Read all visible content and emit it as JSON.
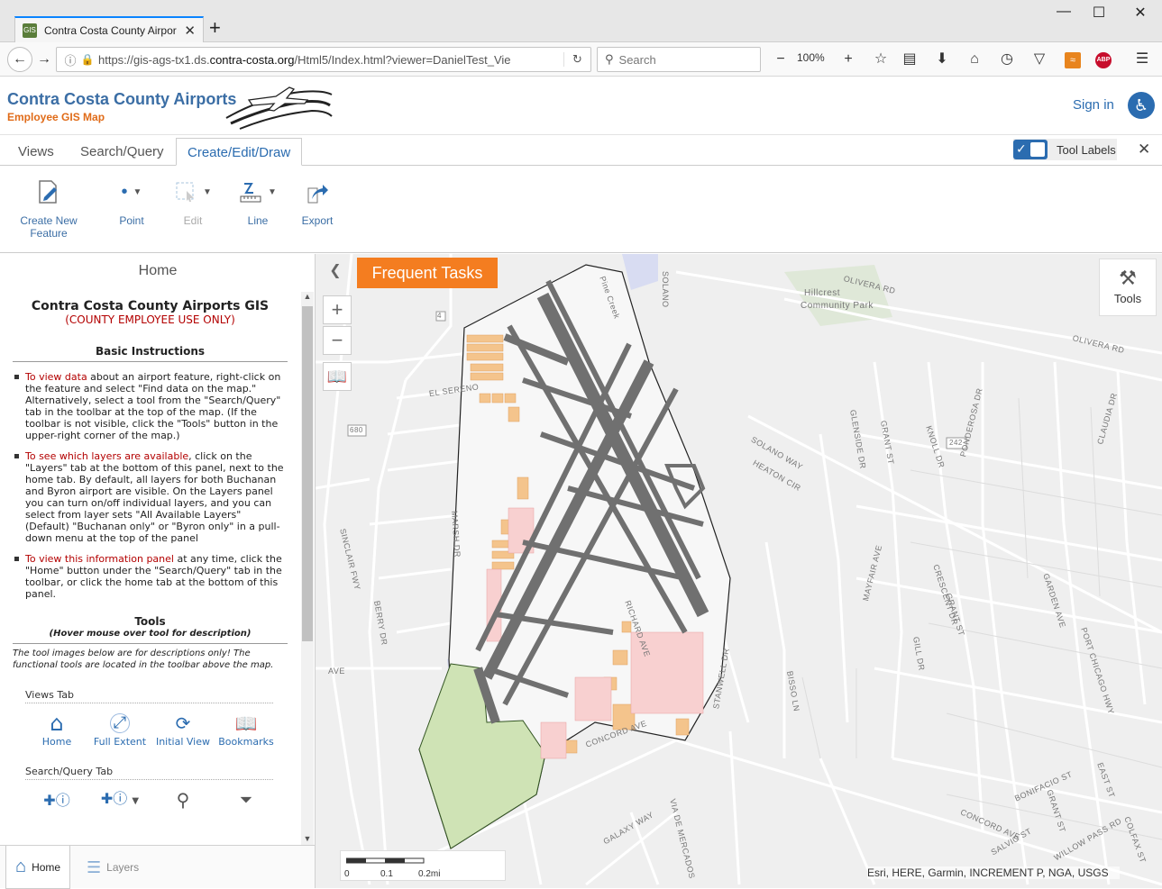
{
  "browser": {
    "tab_title": "Contra Costa County Airpor",
    "favicon_text": "GIS",
    "url_prefix": "https://gis-ags-tx1.ds.",
    "url_domain": "contra-costa.org",
    "url_path": "/Html5/Index.html?viewer=DanielTest_Vie",
    "search_placeholder": "Search",
    "zoom": "100%",
    "icons": [
      "back-icon",
      "forward-icon",
      "info-icon",
      "lock-icon",
      "reload-icon",
      "search-icon",
      "zoom-out-icon",
      "zoom-in-icon",
      "star-icon",
      "library-icon",
      "download-icon",
      "home-icon",
      "history-icon",
      "pocket-icon",
      "rss-icon",
      "adblock-icon",
      "menu-icon"
    ]
  },
  "app": {
    "title": "Contra Costa County Airports",
    "subtitle": "Employee GIS Map",
    "sign_in": "Sign in",
    "accent": "#2b6cb0",
    "orange": "#e06b18"
  },
  "ribbon": {
    "tabs": [
      "Views",
      "Search/Query",
      "Create/Edit/Draw"
    ],
    "active_tab": "Create/Edit/Draw",
    "tool_labels_toggle": "Tool Labels",
    "tools": [
      {
        "label": "Create New Feature",
        "line1": "Create New",
        "line2": "Feature"
      },
      {
        "label": "Point"
      },
      {
        "label": "Edit"
      },
      {
        "label": "Line"
      },
      {
        "label": "Export"
      }
    ]
  },
  "panel": {
    "title": "Home",
    "heading": "Contra Costa County Airports GIS",
    "warning": "(COUNTY EMPLOYEE USE ONLY)",
    "basic": "Basic Instructions",
    "bullets": [
      {
        "lead": "To view data",
        "text": " about an airport feature, right-click on the feature and select \"Find data on the map.\" Alternatively, select a tool from the \"Search/Query\" tab in the toolbar at the top of the map. (If the toolbar is not visible, click the \"Tools\" button in the upper-right corner of the map.)"
      },
      {
        "lead": "To see which layers are available",
        "text": ", click on the \"Layers\" tab at the bottom of this panel, next to the home tab. By default, all layers for both Buchanan and Byron airport are visible. On the Layers panel you can turn on/off individual layers, and you can select from layer sets \"All Available Layers\" (Default) \"Buchanan only\" or \"Byron only\" in a pull-down menu at the top of the panel"
      },
      {
        "lead": "To view this information panel",
        "text": " at any time, click the \"Home\" button under the \"Search/Query\" tab in the toolbar, or click the home tab at the bottom of this panel."
      }
    ],
    "tools_heading": "Tools",
    "tools_hover": "(Hover mouse over tool for description)",
    "tools_note": "The tool images below are for descriptions only! The functional tools are located in the toolbar above the map.",
    "views_tab": "Views Tab",
    "views_items": [
      "Home",
      "Full Extent",
      "Initial View",
      "Bookmarks"
    ],
    "search_tab": "Search/Query Tab",
    "footer_tabs": [
      "Home",
      "Layers"
    ]
  },
  "map": {
    "frequent_tasks": "Frequent Tasks",
    "tools_button": "Tools",
    "scale_labels": [
      "0",
      "0.1",
      "0.2mi"
    ],
    "attribution": "Esri, HERE, Garmin, INCREMENT P, NGA, USGS",
    "labels": {
      "hillcrest": "Hillcrest",
      "community_park": "Community Park",
      "olivera_rd": "OLIVERA RD",
      "olivera_rd2": "OLIVERA RD",
      "concord_ave": "CONCORD AVE",
      "concord_ave2": "CONCORD AVE",
      "solano_way": "SOLANO WAY",
      "heaton_cir": "HEATON CIR",
      "sinclair_fwy": "SINCLAIR FWY",
      "berry_dr": "BERRY DR",
      "richard_ave": "RICHARD AVE",
      "mayfair_ave": "MAYFAIR AVE",
      "bisso_ln": "BISSO LN",
      "stanwell_dr": "STANWELL DR",
      "glenside_dr": "GLENSIDE DR",
      "grant_st": "GRANT ST",
      "grant_st2": "GRANT ST",
      "grant_st3": "GRANT ST",
      "knoll_dr": "KNOLL DR",
      "ponderosa_dr": "PONDEROSA DR",
      "claudia_dr": "CLAUDIA DR",
      "crescent_dr": "CRESCENT DR",
      "gill_dr": "GILL DR",
      "garden_ave": "GARDEN AVE",
      "port_chicago_hwy": "PORT CHICAGO HWY",
      "bonifacio_st": "BONIFACIO ST",
      "galaxy_way": "GALAXY WAY",
      "via_de_mercados": "VIA DE MERCADOS",
      "salvio_st": "SALVIO ST",
      "willow_pass_rd": "WILLOW PASS RD",
      "colfax_st": "COLFAX ST",
      "east_st": "EAST ST",
      "el_sereno": "EL SERENO",
      "hwy_4": "4",
      "hwy_680": "680",
      "hwy_242": "242",
      "pine_creek": "Pine Creek",
      "solano": "SOLANO",
      "marsh_dr": "MARSH DR",
      "ave": "AVE"
    }
  }
}
